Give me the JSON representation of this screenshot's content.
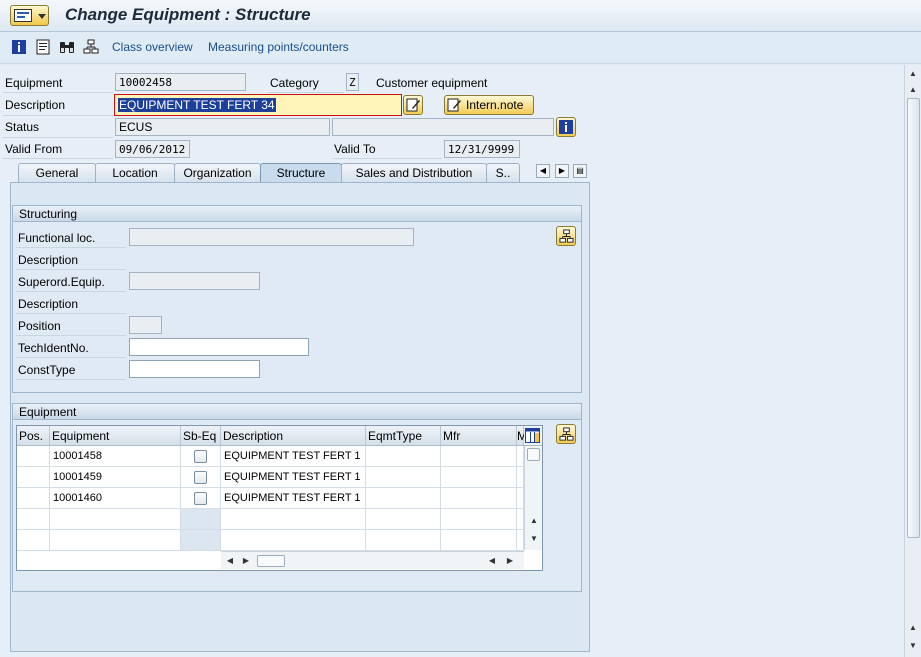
{
  "window": {
    "title": "Change Equipment : Structure"
  },
  "toolbar": {
    "icons": [
      "info-icon",
      "document-icon",
      "binoculars-icon",
      "hierarchy-icon"
    ],
    "class_overview": "Class overview",
    "measuring_points": "Measuring points/counters"
  },
  "header": {
    "equipment_label": "Equipment",
    "equipment_value": "10002458",
    "category_label": "Category",
    "category_value": "Z",
    "category_desc": "Customer equipment",
    "description_label": "Description",
    "description_value": "EQUIPMENT TEST FERT 34",
    "intern_note": "Intern.note",
    "status_label": "Status",
    "status_value": "ECUS",
    "valid_from_label": "Valid From",
    "valid_from_value": "09/06/2012",
    "valid_to_label": "Valid To",
    "valid_to_value": "12/31/9999"
  },
  "tabs": [
    {
      "label": "General"
    },
    {
      "label": "Location"
    },
    {
      "label": "Organization"
    },
    {
      "label": "Structure",
      "active": true
    },
    {
      "label": "Sales and Distribution"
    },
    {
      "label": "S.."
    }
  ],
  "structuring": {
    "title": "Structuring",
    "functional_loc_label": "Functional loc.",
    "description1_label": "Description",
    "superord_label": "Superord.Equip.",
    "description2_label": "Description",
    "position_label": "Position",
    "techident_label": "TechIdentNo.",
    "consttype_label": "ConstType"
  },
  "equipment_group": {
    "title": "Equipment",
    "columns": [
      "Pos.",
      "Equipment",
      "Sb-Eq",
      "Description",
      "EqmtType",
      "Mfr",
      "M"
    ],
    "rows": [
      {
        "pos": "",
        "equipment": "10001458",
        "sbeq": false,
        "description": "EQUIPMENT TEST FERT 1",
        "eqmttype": "",
        "mfr": ""
      },
      {
        "pos": "",
        "equipment": "10001459",
        "sbeq": false,
        "description": "EQUIPMENT TEST FERT 1",
        "eqmttype": "",
        "mfr": ""
      },
      {
        "pos": "",
        "equipment": "10001460",
        "sbeq": false,
        "description": "EQUIPMENT TEST FERT 1",
        "eqmttype": "",
        "mfr": ""
      }
    ]
  }
}
